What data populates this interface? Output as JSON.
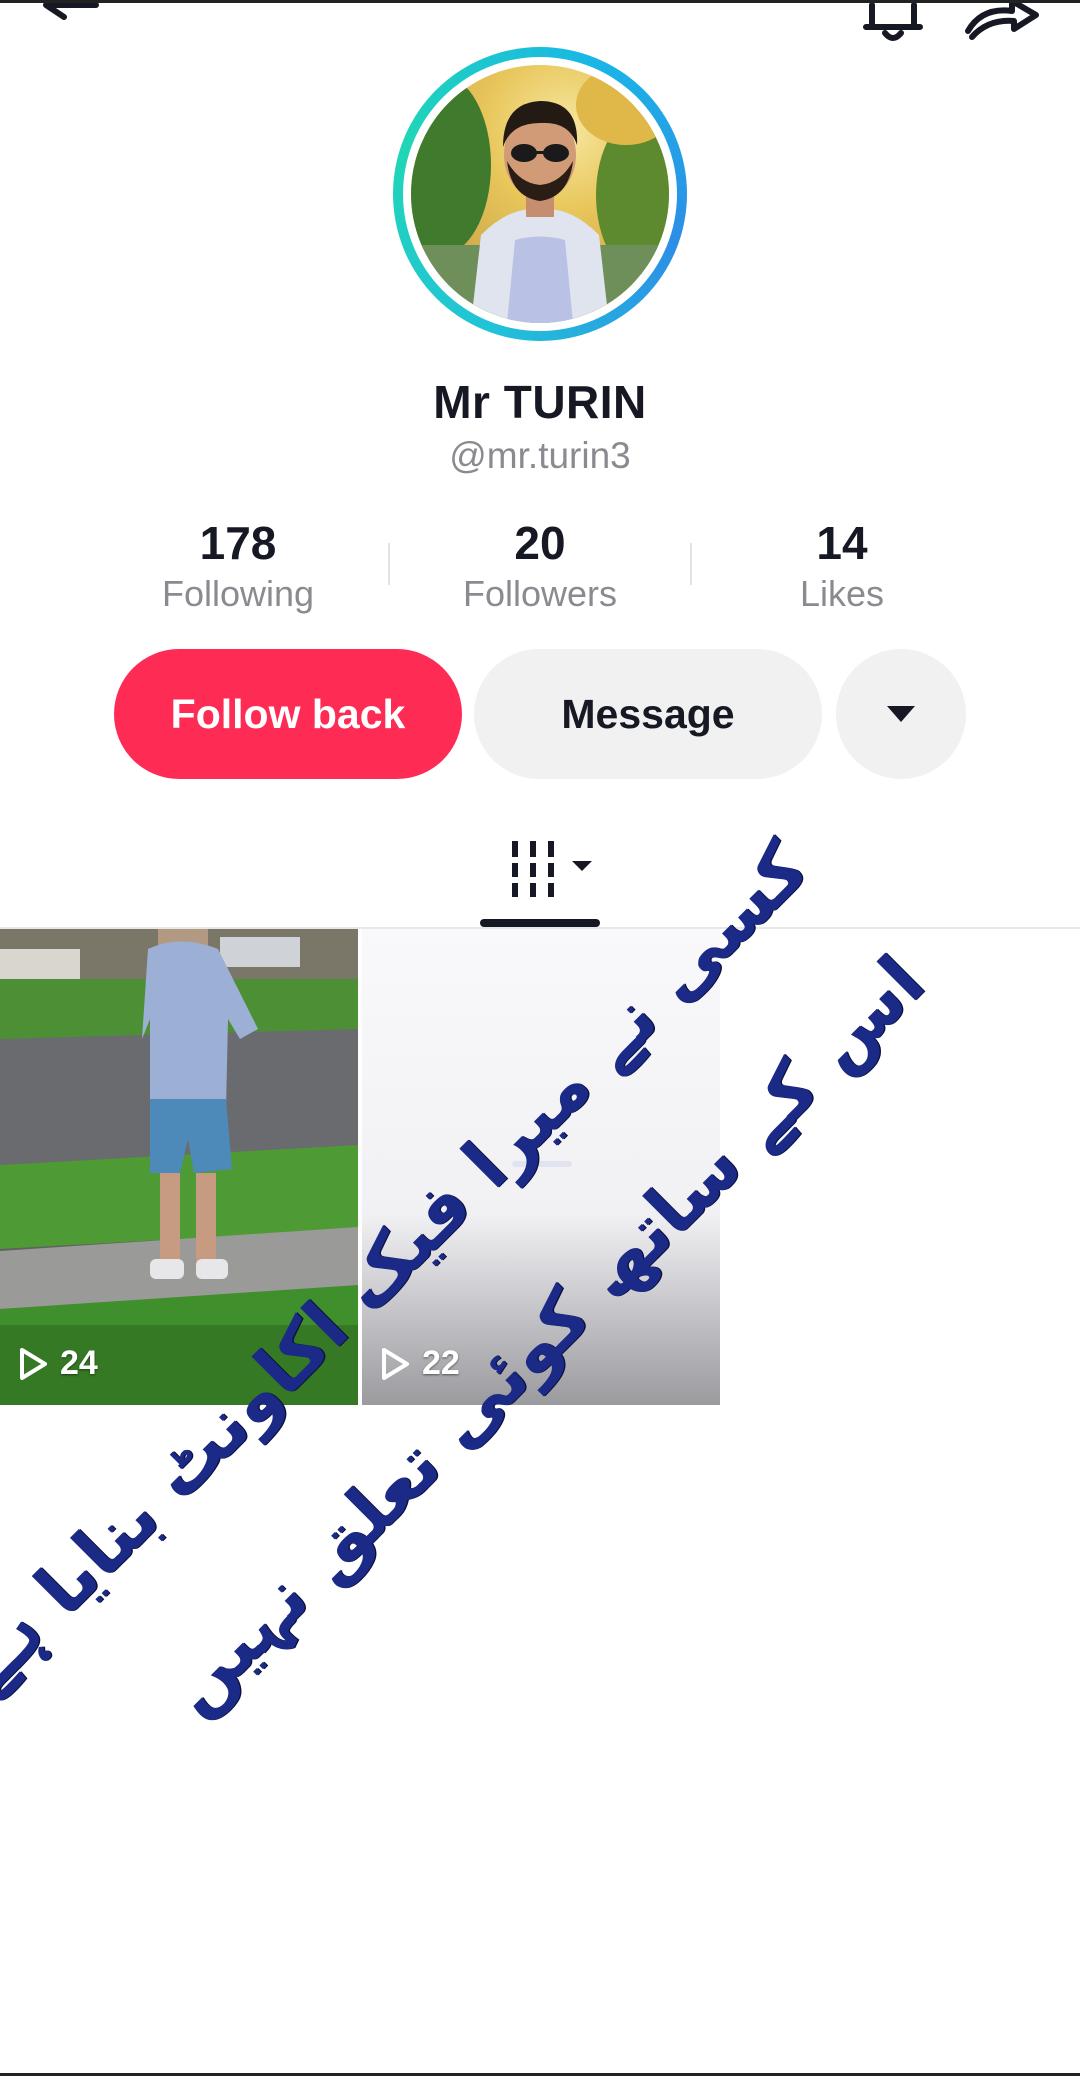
{
  "profile": {
    "display_name": "Mr TURIN",
    "username": "@mr.turin3"
  },
  "stats": [
    {
      "value": "178",
      "label": "Following"
    },
    {
      "value": "20",
      "label": "Followers"
    },
    {
      "value": "14",
      "label": "Likes"
    }
  ],
  "actions": {
    "follow_back": "Follow back",
    "message": "Message"
  },
  "videos": [
    {
      "views": "24"
    },
    {
      "views": "22"
    }
  ],
  "overlay": {
    "line1": "کسی نے میرا فیک اکاونٹ بنایا ہے میرا",
    "line2": "اس کے ساتھ کوئی تعلق نہیں"
  },
  "colors": {
    "follow_button": "#fe2c55",
    "secondary_button": "#f1f1f2",
    "overlay_text": "#1b2a86",
    "avatar_ring": "#21c3d8"
  },
  "icons": {
    "top_left": "back-arrow-icon",
    "top_right": [
      "bell-icon",
      "share-icon"
    ],
    "tab": "grid-icon",
    "more": "caret-down-icon",
    "views": "play-icon"
  }
}
